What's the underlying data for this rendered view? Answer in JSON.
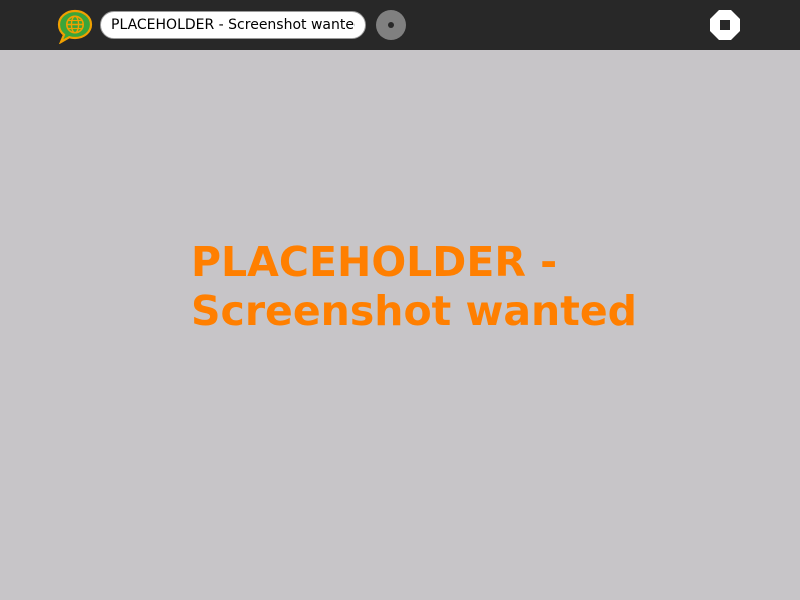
{
  "toolbar": {
    "activity_icon": "globe-chat-icon",
    "title_entry": {
      "value": "PLACEHOLDER - Screenshot wanted"
    },
    "keep_icon": "keep-dot-icon",
    "stop_icon": "stop-icon"
  },
  "canvas": {
    "message_line1": "PLACEHOLDER -",
    "message_line2": "Screenshot wanted"
  },
  "colors": {
    "toolbar_bg": "#282828",
    "canvas_bg": "#c7c5c8",
    "message": "#ff7f00",
    "icon_green": "#3aa53a",
    "icon_orange": "#f0a000"
  }
}
